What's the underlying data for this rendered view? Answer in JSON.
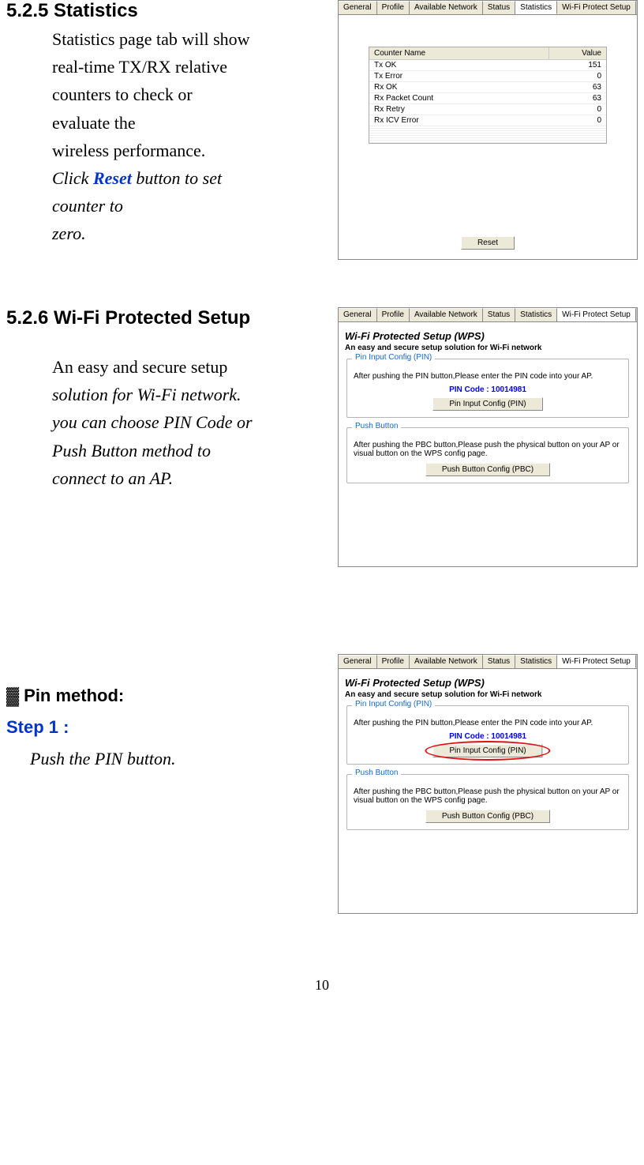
{
  "section1": {
    "heading": "5.2.5 Statistics",
    "line1": "Statistics page tab will show",
    "line2": "real-time TX/RX relative",
    "line3": "counters to check or",
    "line4": "evaluate the",
    "line5": "wireless performance.",
    "click_prefix": "Click ",
    "reset_word": "Reset",
    "click_suffix": " button to set",
    "line7": "counter to",
    "line8": "zero."
  },
  "stats_shot": {
    "tabs": [
      "General",
      "Profile",
      "Available Network",
      "Status",
      "Statistics",
      "Wi-Fi Protect Setup"
    ],
    "active_tab": 4,
    "col1": "Counter Name",
    "col2": "Value",
    "rows": [
      {
        "name": "Tx OK",
        "val": "151"
      },
      {
        "name": "Tx Error",
        "val": "0"
      },
      {
        "name": "Rx OK",
        "val": "63"
      },
      {
        "name": "Rx Packet Count",
        "val": "63"
      },
      {
        "name": "Rx Retry",
        "val": "0"
      },
      {
        "name": "Rx ICV Error",
        "val": "0"
      }
    ],
    "reset_btn": "Reset"
  },
  "section2": {
    "heading": "5.2.6 Wi-Fi Protected Setup",
    "line1": "An easy and secure setup",
    "line2": "solution for Wi-Fi network.",
    "line3": "you can choose PIN Code or",
    "line4": "Push Button method to",
    "line5": "connect to an AP."
  },
  "wps_shot": {
    "tabs": [
      "General",
      "Profile",
      "Available Network",
      "Status",
      "Statistics",
      "Wi-Fi Protect Setup"
    ],
    "active_tab": 5,
    "title": "Wi-Fi Protected Setup (WPS)",
    "subtitle": "An easy and secure setup solution for Wi-Fi network",
    "pin_group_label": "Pin Input Config (PIN)",
    "pin_text": "After pushing the PIN button,Please enter the PIN code into your AP.",
    "pin_code_label": "PIN Code :  10014981",
    "pin_btn": "Pin Input Config (PIN)",
    "push_group_label": "Push Button",
    "push_text": "After pushing the PBC button,Please push the physical button on your AP or visual button on the WPS config page.",
    "push_btn": "Push Button Config (PBC)"
  },
  "pin_method": {
    "heading": "▓ Pin method:",
    "step_label": "Step 1 :",
    "step_text": "Push the PIN button."
  },
  "page_number": "10"
}
